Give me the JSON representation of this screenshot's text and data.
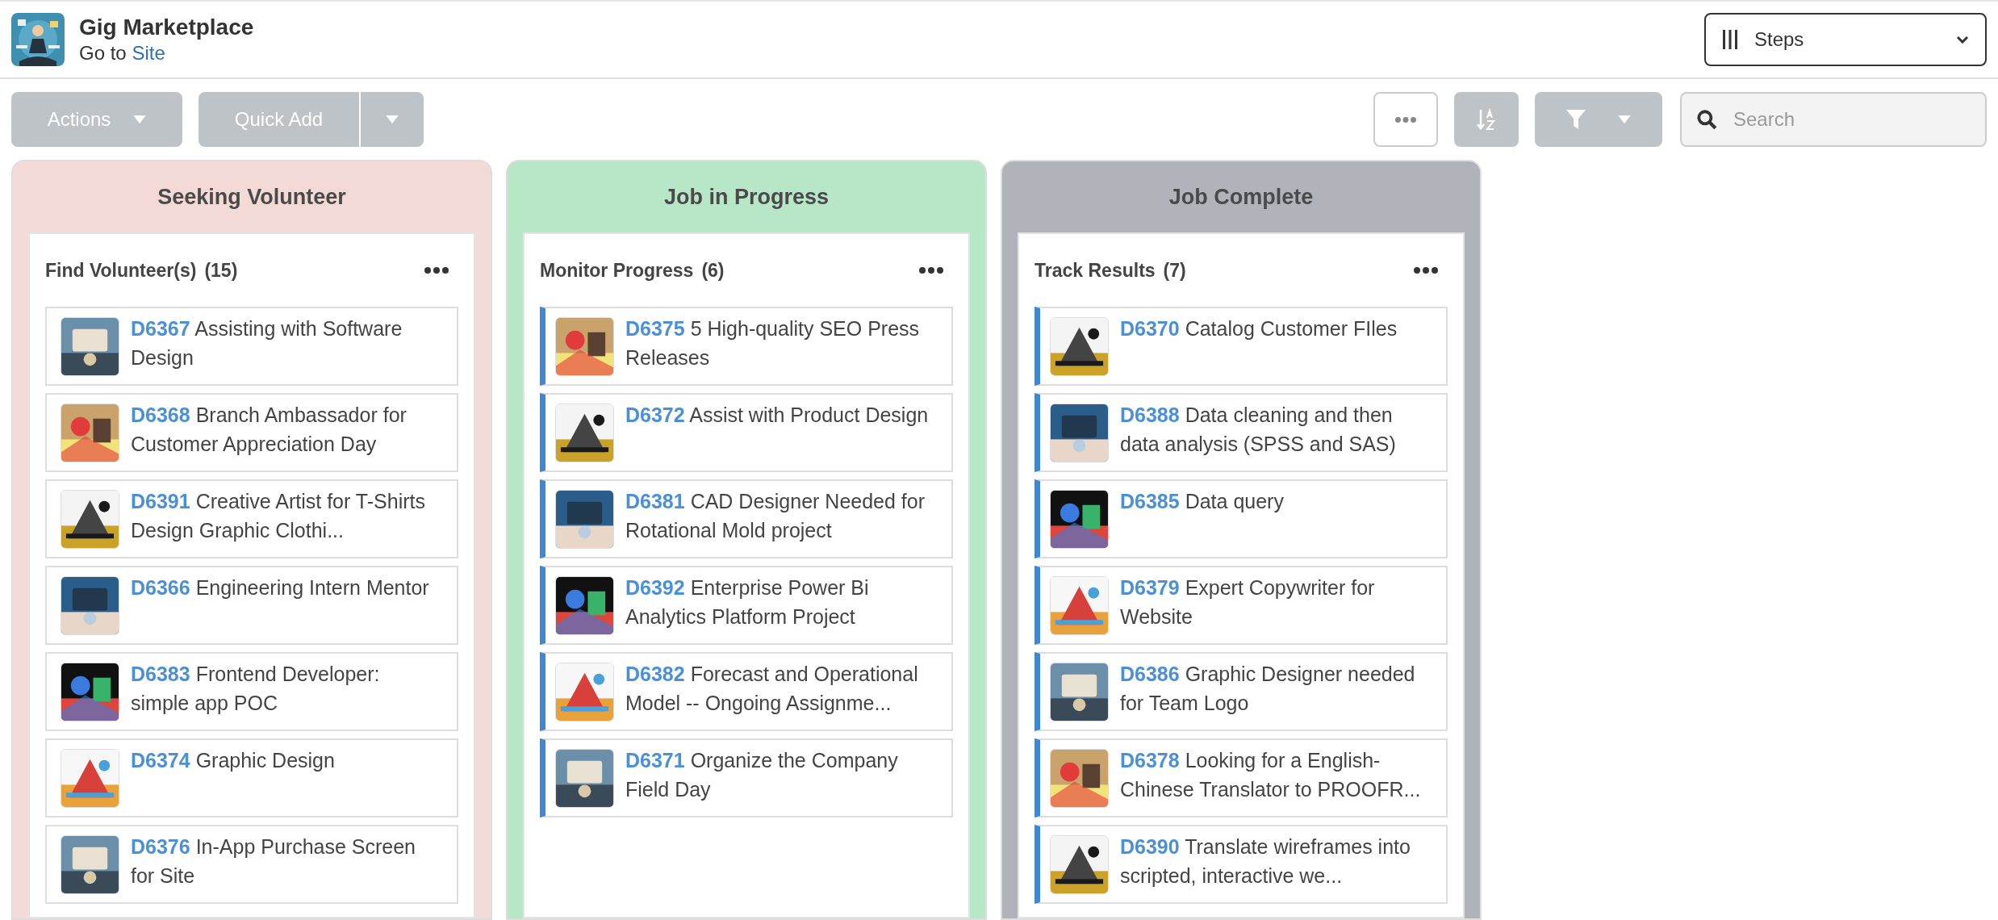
{
  "header": {
    "title": "Gig Marketplace",
    "goto_text": "Go to",
    "goto_link": "Site",
    "view_select": {
      "value": "Steps"
    }
  },
  "toolbar": {
    "actions": "Actions",
    "quick_add": "Quick Add",
    "search": {
      "placeholder": "Search"
    }
  },
  "columns": [
    {
      "title": "Seeking Volunteer",
      "color": "#f4dad6",
      "panel": {
        "title": "Find Volunteer(s)",
        "count": "(15)"
      },
      "cards": [
        {
          "id": "D6367",
          "title": "Assisting with Software Design",
          "highlighted": false
        },
        {
          "id": "D6368",
          "title": "Branch Ambassador for Customer Appreciation Day",
          "highlighted": false
        },
        {
          "id": "D6391",
          "title": "Creative Artist for T-Shirts Design Graphic Clothi...",
          "highlighted": false
        },
        {
          "id": "D6366",
          "title": "Engineering Intern Mentor",
          "highlighted": false
        },
        {
          "id": "D6383",
          "title": "Frontend Developer: simple app POC",
          "highlighted": false
        },
        {
          "id": "D6374",
          "title": "Graphic Design",
          "highlighted": false
        },
        {
          "id": "D6376",
          "title": "In-App Purchase Screen for Site",
          "highlighted": false
        }
      ]
    },
    {
      "title": "Job in Progress",
      "color": "#b8e7c8",
      "panel": {
        "title": "Monitor Progress",
        "count": "(6)"
      },
      "cards": [
        {
          "id": "D6375",
          "title": "5 High-quality SEO Press Releases",
          "highlighted": true
        },
        {
          "id": "D6372",
          "title": "Assist with Product Design",
          "highlighted": true
        },
        {
          "id": "D6381",
          "title": "CAD Designer Needed for Rotational Mold project",
          "highlighted": true
        },
        {
          "id": "D6392",
          "title": "Enterprise Power Bi Analytics Platform Project",
          "highlighted": true
        },
        {
          "id": "D6382",
          "title": "Forecast and Operational Model -- Ongoing Assignme...",
          "highlighted": true
        },
        {
          "id": "D6371",
          "title": "Organize the Company Field Day",
          "highlighted": true
        }
      ]
    },
    {
      "title": "Job Complete",
      "color": "#b0b4ba",
      "panel": {
        "title": "Track Results",
        "count": "(7)"
      },
      "cards": [
        {
          "id": "D6370",
          "title": "Catalog Customer FIles",
          "highlighted": true
        },
        {
          "id": "D6388",
          "title": "Data cleaning and then data analysis (SPSS and SAS)",
          "highlighted": true
        },
        {
          "id": "D6385",
          "title": "Data query",
          "highlighted": true
        },
        {
          "id": "D6379",
          "title": "Expert Copywriter for Website",
          "highlighted": true
        },
        {
          "id": "D6386",
          "title": "Graphic Designer needed for Team Logo",
          "highlighted": true
        },
        {
          "id": "D6378",
          "title": "Looking for a English-Chinese Translator to PROOFR...",
          "highlighted": true
        },
        {
          "id": "D6390",
          "title": "Translate wireframes into scripted, interactive we...",
          "highlighted": true
        }
      ]
    }
  ]
}
